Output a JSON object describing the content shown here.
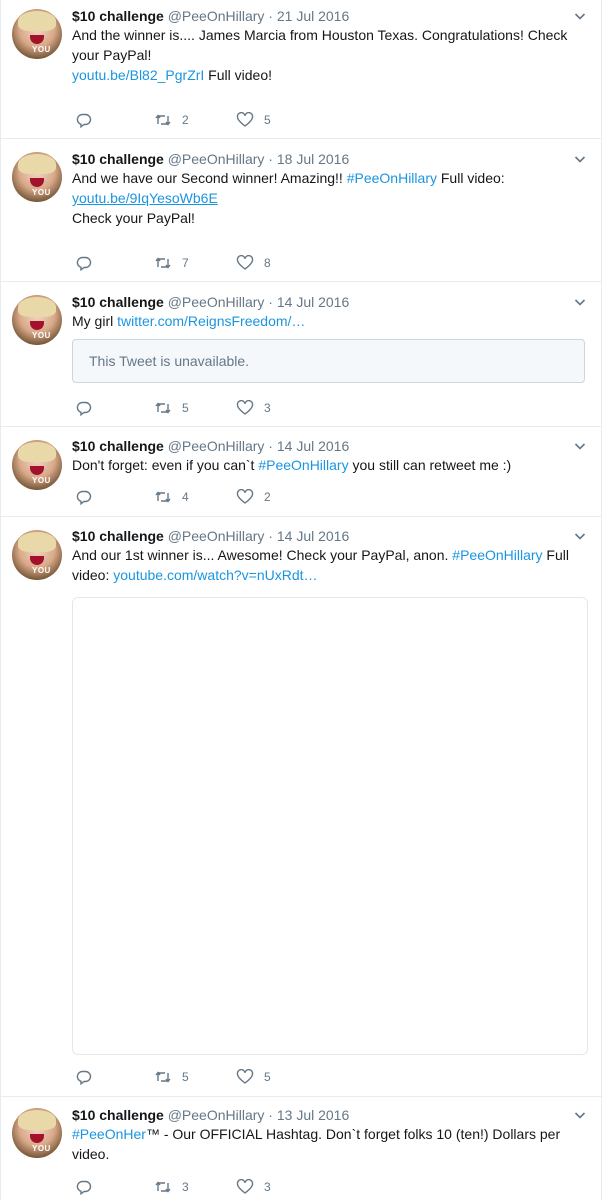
{
  "tweets": [
    {
      "name": "$10 challenge",
      "handle": "@PeeOnHillary",
      "date": "21 Jul 2016",
      "line1": "And the winner is.... James Marcia from Houston Texas. Congratulations! Check your PayPal!",
      "link": "youtu.be/Bl82_PgrZrI",
      "after_link": " Full video!",
      "retweets": "2",
      "likes": "5"
    },
    {
      "name": "$10 challenge",
      "handle": "@PeeOnHillary",
      "date": "18 Jul 2016",
      "line1": "And we have our Second winner! Amazing!! ",
      "hashtag": "#PeeOnHillary",
      "after_hashtag": " Full video:",
      "link": "youtu.be/9IqYesoWb6E",
      "line3": "Check your PayPal!",
      "retweets": "7",
      "likes": "8"
    },
    {
      "name": "$10 challenge",
      "handle": "@PeeOnHillary",
      "date": "14 Jul 2016",
      "line1": "My girl ",
      "link": "twitter.com/ReignsFreedom/…",
      "quote": "This Tweet is unavailable.",
      "retweets": "5",
      "likes": "3"
    },
    {
      "name": "$10 challenge",
      "handle": "@PeeOnHillary",
      "date": "14 Jul 2016",
      "line1": "Don't forget: even if you can`t ",
      "hashtag": "#PeeOnHillary",
      "after_hashtag": " you still can retweet me :)",
      "retweets": "4",
      "likes": "2"
    },
    {
      "name": "$10 challenge",
      "handle": "@PeeOnHillary",
      "date": "14 Jul 2016",
      "line1": "And our 1st winner is... Awesome! Check your PayPal, anon. ",
      "hashtag": "#PeeOnHillary",
      "after_hashtag": " Full video: ",
      "link": "youtube.com/watch?v=nUxRdt…",
      "retweets": "5",
      "likes": "5"
    },
    {
      "name": "$10 challenge",
      "handle": "@PeeOnHillary",
      "date": "13 Jul 2016",
      "hashtag": "#PeeOnHer",
      "after_hashtag": "™ - Our OFFICIAL Hashtag. Don`t forget folks 10 (ten!) Dollars per video.",
      "retweets": "3",
      "likes": "3"
    }
  ],
  "sep": " · ",
  "avatar_badge": "YOU",
  "colors": {
    "link": "#1b95e0",
    "secondary": "#657786",
    "border": "#e6ecf0"
  }
}
